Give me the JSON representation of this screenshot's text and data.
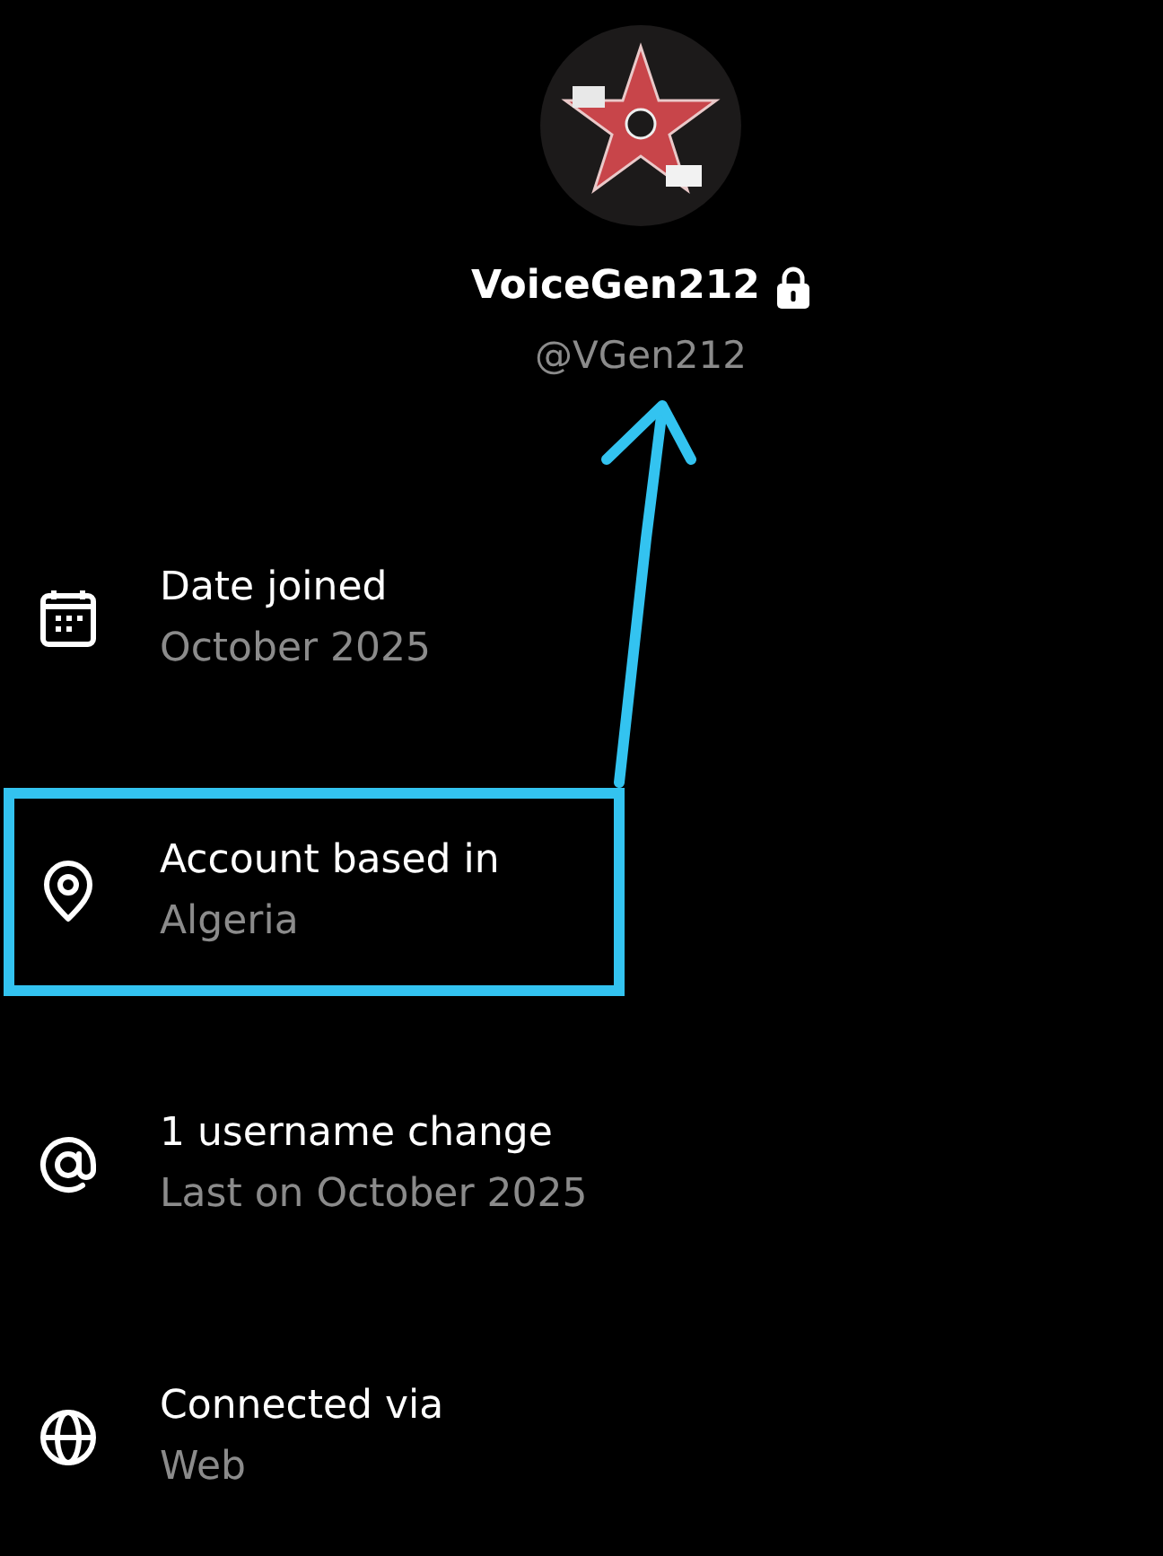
{
  "profile": {
    "display_name": "VoiceGen212",
    "protected": true,
    "handle": "@VGen212"
  },
  "details": [
    {
      "kind": "calendar",
      "title": "Date joined",
      "value": "October 2025",
      "highlighted": false
    },
    {
      "kind": "location",
      "title": "Account based in",
      "value": "Algeria",
      "highlighted": true
    },
    {
      "kind": "at",
      "title": "1 username change",
      "value": "Last on October 2025",
      "highlighted": false
    },
    {
      "kind": "globe",
      "title": "Connected via",
      "value": "Web",
      "highlighted": false
    }
  ],
  "annotation": {
    "arrow": true
  }
}
